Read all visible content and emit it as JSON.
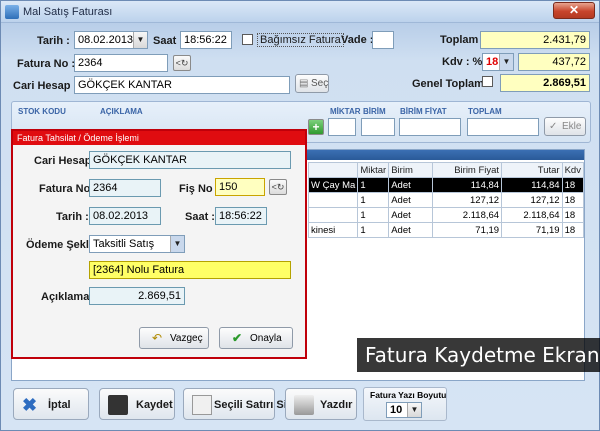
{
  "window": {
    "title": "Mal Satış Faturası",
    "close_glyph": "✕"
  },
  "header": {
    "tarih_label": "Tarih :",
    "tarih_value": "08.02.2013",
    "saat_label": "Saat :",
    "saat_value": "18:56:22",
    "bagimsiz_label": "Bağımsız Fatura",
    "vade_label": "Vade :",
    "vade_value": "",
    "fatura_no_label": "Fatura No :",
    "fatura_no_value": "2364",
    "cari_label": "Cari Hesap :",
    "cari_value": "GÖKÇEK KANTAR",
    "sec_label": "Seç",
    "toplam_label": "Toplam :",
    "toplam_value": "2.431,79",
    "kdv_label": "Kdv : %",
    "kdv_rate": "18",
    "kdv_value": "437,72",
    "genel_label": "Genel Toplam :",
    "genel_value": "2.869,51"
  },
  "entry": {
    "stok_kodu": "STOK KODU",
    "aciklama": "AÇIKLAMA",
    "miktar": "MİKTAR",
    "birim": "BİRİM",
    "birim_fiyat": "BİRİM FİYAT",
    "toplam": "TOPLAM",
    "ekle": "Ekle",
    "plus": "+"
  },
  "grid": {
    "headers": [
      "Miktar",
      "Birim",
      "Birim Fiyat",
      "Tutar",
      "Kdv"
    ],
    "rows": [
      {
        "desc": "W Çay Ma",
        "miktar": "1",
        "birim": "Adet",
        "fiyat": "114,84",
        "tutar": "114,84",
        "kdv": "18"
      },
      {
        "desc": "",
        "miktar": "1",
        "birim": "Adet",
        "fiyat": "127,12",
        "tutar": "127,12",
        "kdv": "18"
      },
      {
        "desc": "",
        "miktar": "1",
        "birim": "Adet",
        "fiyat": "2.118,64",
        "tutar": "2.118,64",
        "kdv": "18"
      },
      {
        "desc": "kinesi",
        "miktar": "1",
        "birim": "Adet",
        "fiyat": "71,19",
        "tutar": "71,19",
        "kdv": "18"
      }
    ]
  },
  "toolbar": {
    "iptal": "İptal",
    "kaydet": "Kaydet",
    "secili_sil": "Seçili Satırı Sil",
    "yazdir": "Yazdır",
    "font_size_label": "Fatura Yazı Boyutu",
    "font_size_value": "10"
  },
  "dialog": {
    "title": "Fatura Tahsilat / Ödeme İşlemi",
    "cari_label": "Cari Hesap :",
    "cari_value": "GÖKÇEK KANTAR",
    "fatura_no_label": "Fatura No :",
    "fatura_no_value": "2364",
    "fis_no_label": "Fiş No :",
    "fis_no_value": "150",
    "tarih_label": "Tarih :",
    "tarih_value": "08.02.2013",
    "saat_label": "Saat :",
    "saat_value": "18:56:22",
    "odeme_label": "Ödeme Şekli :",
    "odeme_value": "Taksitli Satış",
    "aciklama_value": "[2364] Nolu Fatura",
    "tutar_label": "Açıklama :",
    "tutar_value": "2.869,51",
    "vazgec": "Vazgeç",
    "onayla": "Onayla"
  },
  "caption": "Fatura Kaydetme Ekranı",
  "colors": {
    "accent_red": "#e00c10",
    "highlight_yellow": "#ffff66",
    "kdv_red": "#e00000"
  }
}
